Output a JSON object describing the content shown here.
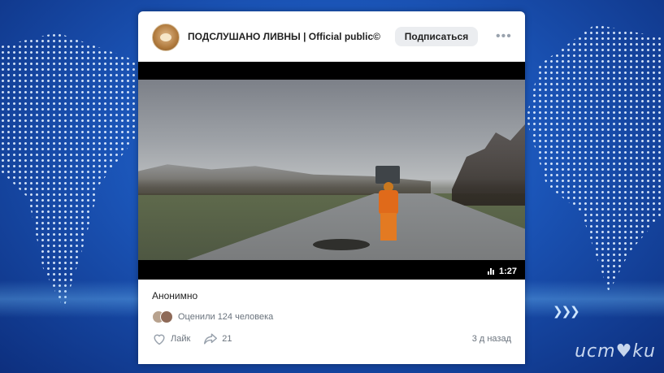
{
  "post": {
    "group_name": "ПОДСЛУШАНО ЛИВНЫ | Official public©",
    "subscribe_label": "Подписаться",
    "more_label": "•••",
    "video_duration": "1:27",
    "text": "Анонимно",
    "rated_text": "Оценили 124 человека",
    "like_label": "Лайк",
    "share_count": "21",
    "timestamp": "3 д назад"
  },
  "overlay": {
    "arrows": "❯❯❯",
    "watermark": "ucm♥ku"
  },
  "colors": {
    "background": "#1b55b8",
    "accent_orange": "#e06a1a",
    "muted_text": "#6a737d"
  },
  "icons": {
    "avatar": "bear-avatar-icon",
    "like": "heart-icon",
    "share": "share-arrow-icon",
    "duration": "bars-icon"
  }
}
